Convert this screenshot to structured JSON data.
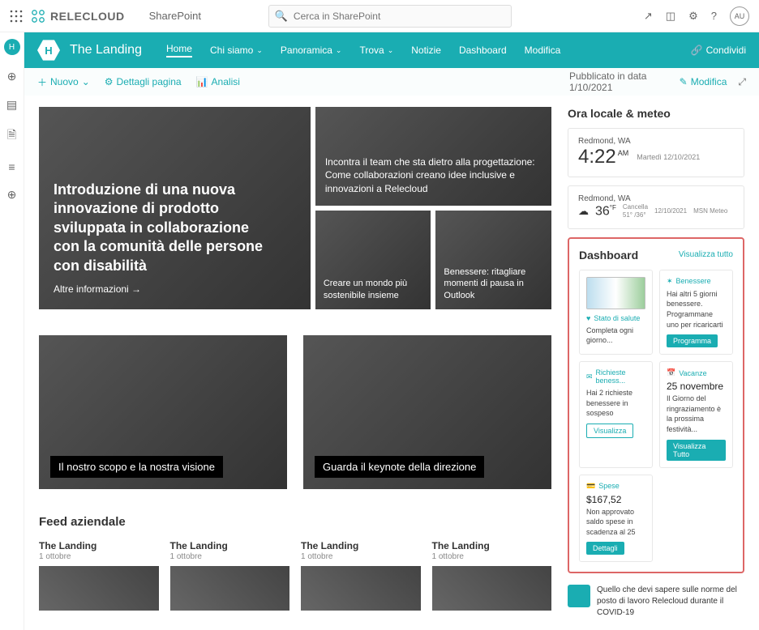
{
  "topbar": {
    "brand": "RELECLOUD",
    "app": "SharePoint",
    "search_placeholder": "Cerca in SharePoint",
    "avatar": "AU"
  },
  "site": {
    "hex": "H",
    "title": "The Landing"
  },
  "nav": {
    "home": "Home",
    "about": "Chi siamo",
    "overview": "Panoramica",
    "find": "Trova",
    "news": "Notizie",
    "dashboard": "Dashboard",
    "edit": "Modifica",
    "share": "Condividi"
  },
  "cmd": {
    "new": "Nuovo",
    "details": "Dettagli pagina",
    "analytics": "Analisi",
    "published": "Pubblicato in data 1/10/2021",
    "edit": "Modifica"
  },
  "hero": {
    "big_title": "Introduzione di una nuova innovazione di prodotto sviluppata in collaborazione con la comunità delle persone con disabilità",
    "big_more": "Altre informazioni →",
    "wide": "Incontra il team che sta dietro alla progettazione: Come collaborazioni creano idee inclusive e innovazioni a Relecloud",
    "sm1": "Creare un mondo più sostenibile insieme",
    "sm2": "Benessere: ritagliare momenti di pausa in Outlook"
  },
  "tworow": {
    "a": "Il nostro scopo e la nostra visione",
    "b": "Guarda il keynote della direzione"
  },
  "feed": {
    "title": "Feed aziendale",
    "card_title": "The Landing",
    "card_date": "1 ottobre"
  },
  "weather": {
    "section": "Ora locale & meteo",
    "loc": "Redmond, WA",
    "time": "4:22",
    "ampm": "AM",
    "date": "Martedì 12/10/2021",
    "temp": "36",
    "unit": "°F",
    "cancel": "Cancella",
    "range": "51° /36°",
    "wdate": "12/10/2021",
    "src": "MSN Meteo"
  },
  "dash": {
    "title": "Dashboard",
    "viewall": "Visualizza tutto",
    "health_label": "Stato di salute",
    "health_text": "Completa ogni giorno...",
    "well_label": "Benessere",
    "well_text": "Hai altri 5 giorni benessere. Programmane uno per ricaricarti",
    "well_btn": "Programma",
    "req_label": "Richieste beness...",
    "req_text": "Hai 2 richieste benessere in sospeso",
    "req_btn": "Visualizza",
    "vac_label": "Vacanze",
    "vac_date": "25 novembre",
    "vac_text": "Il Giorno del ringraziamento è la prossima festività...",
    "vac_btn": "Visualizza Tutto",
    "exp_label": "Spese",
    "exp_amt": "$167,52",
    "exp_text": "Non approvato saldo spese in scadenza al 25",
    "exp_btn": "Dettagli"
  },
  "banner": "Quello che devi sapere sulle norme del posto di lavoro Relecloud durante il COVID-19"
}
